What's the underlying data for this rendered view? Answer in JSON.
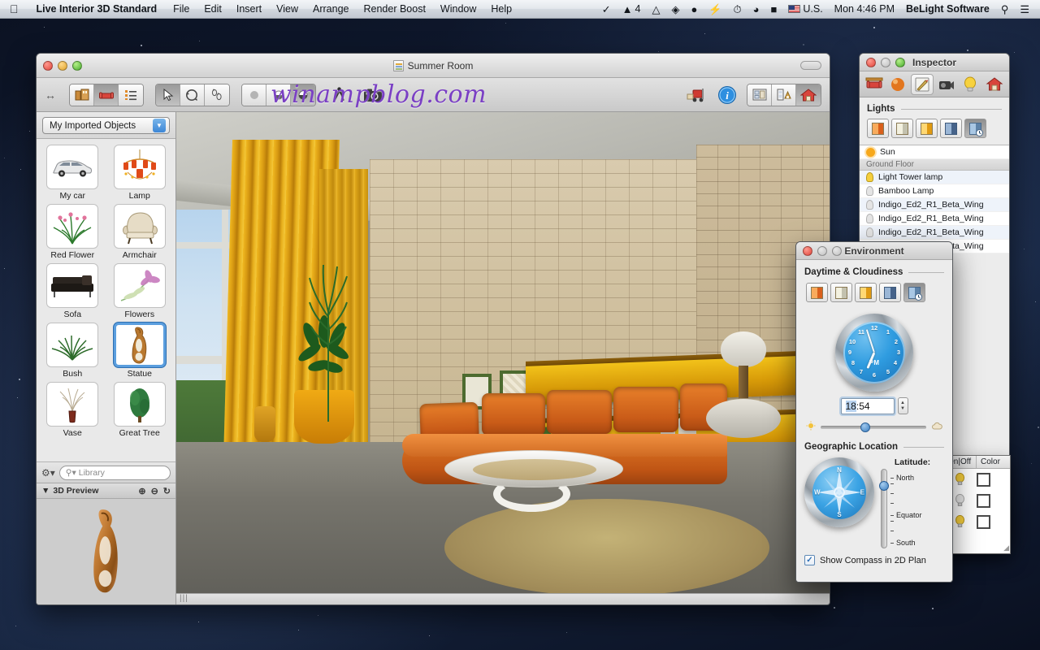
{
  "menubar": {
    "apple_icon": "apple-icon",
    "app_name": "Live Interior 3D Standard",
    "items": [
      "File",
      "Edit",
      "Insert",
      "View",
      "Arrange",
      "Render Boost",
      "Window",
      "Help"
    ],
    "right": {
      "icons": [
        "check-badge-icon",
        "adobe-icon",
        "google-drive-icon",
        "dropbox-icon",
        "evernote-icon",
        "flash-icon",
        "time-machine-icon",
        "wifi-icon",
        "battery-icon"
      ],
      "adobe_count": "4",
      "input_source": "U.S.",
      "clock": "Mon 4:46 PM",
      "user": "BeLight Software",
      "spotlight_icon": "search-icon",
      "notification_icon": "notification-center-icon"
    }
  },
  "main_window": {
    "title": "Summer Room",
    "watermark": "winampblog.com",
    "toolbar": {
      "resize_icon": "resize-arrows-icon",
      "mode_buttons": [
        {
          "name": "floor-plan-button",
          "icon": "building-icon",
          "active": false
        },
        {
          "name": "interior-button",
          "icon": "armchair-icon",
          "active": true
        },
        {
          "name": "object-list-button",
          "icon": "list-icon",
          "active": false
        }
      ],
      "tool_buttons": [
        {
          "name": "select-tool",
          "icon": "arrow-cursor-icon",
          "active": true
        },
        {
          "name": "orbit-tool",
          "icon": "orbit-icon",
          "active": false
        },
        {
          "name": "walk-tool",
          "icon": "footsteps-icon",
          "active": false
        }
      ],
      "quality_buttons": [
        {
          "name": "wireframe-quality",
          "icon": "solid-sphere-icon",
          "active": false
        },
        {
          "name": "medium-quality",
          "icon": "half-sphere-icon",
          "active": false
        },
        {
          "name": "high-quality",
          "icon": "shaded-sphere-icon",
          "active": true
        }
      ],
      "walk_icon": "walking-person-icon",
      "camera_icon": "camera-icon",
      "render_icon": "render-truck-icon",
      "info_icon": "info-icon",
      "view_buttons": [
        {
          "name": "plan-view-button",
          "icon": "plan-view-icon",
          "active": false
        },
        {
          "name": "split-view-button",
          "icon": "split-view-icon",
          "active": false
        },
        {
          "name": "house-view-button",
          "icon": "house-icon",
          "active": true
        }
      ]
    },
    "sidebar": {
      "popup_value": "My Imported Objects",
      "popup_arrow_icon": "chevron-down-icon",
      "objects": [
        {
          "label": "My car",
          "icon": "car-icon",
          "selected": false
        },
        {
          "label": "Lamp",
          "icon": "chandelier-icon",
          "selected": false
        },
        {
          "label": "Red Flower",
          "icon": "flower-grass-icon",
          "selected": false
        },
        {
          "label": "Armchair",
          "icon": "armchair-icon",
          "selected": false
        },
        {
          "label": "Sofa",
          "icon": "sofa-icon",
          "selected": false
        },
        {
          "label": "Flowers",
          "icon": "flower-icon",
          "selected": false
        },
        {
          "label": "Bush",
          "icon": "bush-icon",
          "selected": false
        },
        {
          "label": "Statue",
          "icon": "statue-icon",
          "selected": true
        },
        {
          "label": "Vase",
          "icon": "vase-icon",
          "selected": false
        },
        {
          "label": "Great Tree",
          "icon": "tree-icon",
          "selected": false
        }
      ],
      "gear_icon": "gear-icon",
      "search_icon": "search-icon",
      "search_placeholder": "Library",
      "preview_title": "3D Preview",
      "preview_buttons": [
        "zoom-in-icon",
        "zoom-out-icon",
        "rotate-icon"
      ]
    }
  },
  "inspector": {
    "title": "Inspector",
    "tabs": [
      {
        "name": "object-tab",
        "icon": "sofa-icon",
        "active": false
      },
      {
        "name": "material-tab",
        "icon": "sphere-icon",
        "active": false
      },
      {
        "name": "edit-tab",
        "icon": "pencil-tab-icon",
        "active": true
      },
      {
        "name": "camera-tab",
        "icon": "camera-icon",
        "active": false
      },
      {
        "name": "lights-tab",
        "icon": "lightbulb-icon",
        "active": false
      },
      {
        "name": "house-tab",
        "icon": "house-icon",
        "active": false
      }
    ],
    "section_title": "Lights",
    "light_presets": [
      {
        "name": "preset-morning",
        "active": false
      },
      {
        "name": "preset-day",
        "active": false
      },
      {
        "name": "preset-evening",
        "active": false
      },
      {
        "name": "preset-night",
        "active": false
      },
      {
        "name": "preset-custom",
        "active": true
      }
    ],
    "list": [
      {
        "label": "Sun",
        "icon": "sun-icon",
        "type": "item"
      },
      {
        "label": "Ground Floor",
        "type": "group"
      },
      {
        "label": "Light Tower lamp",
        "icon": "lightbulb-icon",
        "type": "item"
      },
      {
        "label": "Bamboo Lamp",
        "icon": "lightbulb-off-icon",
        "type": "item"
      },
      {
        "label": "Indigo_Ed2_R1_Beta_Wing",
        "icon": "lightbulb-off-icon",
        "type": "item"
      },
      {
        "label": "Indigo_Ed2_R1_Beta_Wing",
        "icon": "lightbulb-off-icon",
        "type": "item"
      },
      {
        "label": "Indigo_Ed2_R1_Beta_Wing",
        "icon": "lightbulb-off-icon",
        "type": "item"
      },
      {
        "label": "Indigo_Ed2_R1_Beta_Wing",
        "icon": "lightbulb-off-icon",
        "type": "item"
      }
    ]
  },
  "lights_table": {
    "columns": [
      "On|Off",
      "Color"
    ],
    "rows": [
      {
        "on": true,
        "color": "#ffffff"
      },
      {
        "on": false,
        "color": "#ffffff"
      },
      {
        "on": true,
        "color": "#ffffff"
      }
    ],
    "resize_grip_icon": "resize-grip-icon"
  },
  "environment": {
    "title": "Environment",
    "daytime_section": "Daytime & Cloudiness",
    "presets": [
      {
        "name": "daytime-preset-sunrise",
        "active": false
      },
      {
        "name": "daytime-preset-day",
        "active": false
      },
      {
        "name": "daytime-preset-sunset",
        "active": false
      },
      {
        "name": "daytime-preset-night",
        "active": false
      },
      {
        "name": "daytime-preset-custom",
        "active": true
      }
    ],
    "clock": {
      "numbers": [
        "12",
        "1",
        "2",
        "3",
        "4",
        "5",
        "6",
        "7",
        "8",
        "9",
        "10",
        "11"
      ],
      "meridiem": "PM"
    },
    "time_value": "18:54",
    "time_hours": "18",
    "time_minutes": ":54",
    "stepper_icon": "stepper-icon",
    "cloud_slider": {
      "left_icon": "sun-icon",
      "right_icon": "cloud-icon",
      "value_percent": 38
    },
    "geo_section": "Geographic Location",
    "compass_icon": "compass-icon",
    "compass_directions": [
      "N",
      "E",
      "S",
      "W"
    ],
    "latitude_label": "Latitude:",
    "latitude_ticks": [
      "North",
      "",
      "",
      "",
      "Equator",
      "",
      "",
      "",
      "South"
    ],
    "latitude_value_percent": 15,
    "checkbox_label": "Show Compass in 2D Plan",
    "checkbox_checked": true,
    "check_glyph": "✓"
  }
}
